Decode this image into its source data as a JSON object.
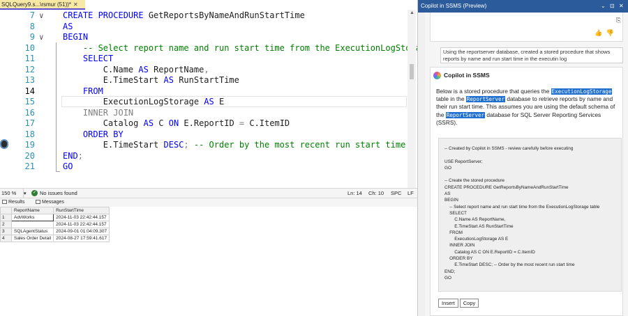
{
  "document_tab": {
    "title": "SQLQuery9.s...\\rsmur (51))*",
    "close_label": "✕"
  },
  "editor": {
    "lines": [
      {
        "number": "7",
        "fold": "∨",
        "parts": [
          {
            "cls": "k",
            "text": "CREATE PROCEDURE "
          },
          {
            "cls": "t",
            "text": "GetReportsByNameAndRunStartTime"
          }
        ]
      },
      {
        "number": "8",
        "fold": "",
        "parts": [
          {
            "cls": "k",
            "text": "AS"
          }
        ]
      },
      {
        "number": "9",
        "fold": "∨",
        "parts": [
          {
            "cls": "k",
            "text": "BEGIN"
          }
        ]
      },
      {
        "number": "10",
        "fold": "",
        "parts": [
          {
            "cls": "c",
            "text": "    -- Select report name and run start time from the ExecutionLogStorage"
          }
        ]
      },
      {
        "number": "11",
        "fold": "",
        "parts": [
          {
            "cls": "k",
            "text": "    SELECT"
          }
        ]
      },
      {
        "number": "12",
        "fold": "",
        "parts": [
          {
            "cls": "t",
            "text": "        C.Name "
          },
          {
            "cls": "k",
            "text": "AS "
          },
          {
            "cls": "t",
            "text": "ReportName"
          },
          {
            "cls": "g",
            "text": ","
          }
        ]
      },
      {
        "number": "13",
        "fold": "",
        "parts": [
          {
            "cls": "t",
            "text": "        E.TimeStart "
          },
          {
            "cls": "k",
            "text": "AS "
          },
          {
            "cls": "t",
            "text": "RunStartTime"
          }
        ]
      },
      {
        "number": "14",
        "fold": "",
        "parts": [
          {
            "cls": "k",
            "text": "    FROM"
          }
        ],
        "current": true
      },
      {
        "number": "15",
        "fold": "",
        "parts": [
          {
            "cls": "t",
            "text": "        ExecutionLogStorage "
          },
          {
            "cls": "k",
            "text": "AS "
          },
          {
            "cls": "t",
            "text": "E"
          }
        ]
      },
      {
        "number": "16",
        "fold": "",
        "parts": [
          {
            "cls": "g",
            "text": "    INNER JOIN"
          }
        ]
      },
      {
        "number": "17",
        "fold": "",
        "parts": [
          {
            "cls": "t",
            "text": "        Catalog "
          },
          {
            "cls": "k",
            "text": "AS "
          },
          {
            "cls": "t",
            "text": "C "
          },
          {
            "cls": "k",
            "text": "ON "
          },
          {
            "cls": "t",
            "text": "E.ReportID "
          },
          {
            "cls": "g",
            "text": "= "
          },
          {
            "cls": "t",
            "text": "C.ItemID"
          }
        ]
      },
      {
        "number": "18",
        "fold": "",
        "parts": [
          {
            "cls": "k",
            "text": "    ORDER BY"
          }
        ]
      },
      {
        "number": "19",
        "fold": "",
        "parts": [
          {
            "cls": "t",
            "text": "        E.TimeStart "
          },
          {
            "cls": "k",
            "text": "DESC"
          },
          {
            "cls": "g",
            "text": "; "
          },
          {
            "cls": "c",
            "text": "-- Order by the most recent run start time"
          }
        ]
      },
      {
        "number": "20",
        "fold": "",
        "parts": [
          {
            "cls": "k",
            "text": "END"
          },
          {
            "cls": "g",
            "text": ";"
          }
        ]
      },
      {
        "number": "21",
        "fold": "",
        "parts": [
          {
            "cls": "k",
            "text": "GO"
          }
        ]
      }
    ]
  },
  "status": {
    "zoom": "150 %",
    "issues": "No issues found",
    "ln": "Ln: 14",
    "ch": "Ch: 10",
    "mode": "SPC",
    "eol": "LF"
  },
  "results": {
    "tabs": {
      "results": "Results",
      "messages": "Messages"
    },
    "columns": [
      "ReportName",
      "RunStartTime"
    ],
    "rows": [
      {
        "n": "1",
        "name": "AdvWorks",
        "time": "2024-11-03 22:42:44.157"
      },
      {
        "n": "2",
        "name": "",
        "time": "2024-11-03 22:42:44.157"
      },
      {
        "n": "3",
        "name": "SQLAgentStatus",
        "time": "2024-09-01 01:04:09.307"
      },
      {
        "n": "4",
        "name": "Sales Order Detail",
        "time": "2024-08-27 17:59:41.617"
      }
    ]
  },
  "copilot": {
    "title": "Copilot in SSMS (Preview)",
    "window_controls": [
      "⌄",
      "⊡",
      "✕"
    ],
    "prompt": "Using the reportserver database, created a stored procedure that shows reports by name and run start time  in the executin log",
    "heading": "Copilot in SSMS",
    "intro": {
      "p1": "Below is a stored procedure that queries the",
      "hl1": "ExecutionLogStorage",
      "p2": " table in the ",
      "hl2": "ReportServer",
      "p3": " database to retrieve reports by name and their run start time. This assumes you are using the default schema of the ",
      "hl3": "ReportServer",
      "p4": " database for SQL Server Reporting Services (SSRS)."
    },
    "code_lines": [
      "-- Created by Copilot in SSMS - review carefully before executing",
      "",
      "USE ReportServer;",
      "GO",
      "",
      "-- Create the stored procedure",
      "CREATE PROCEDURE GetReportsByNameAndRunStartTime",
      "AS",
      "BEGIN",
      "    -- Select report name and run start time from the ExecutionLogStorage table",
      "    SELECT",
      "        C.Name AS ReportName,",
      "        E.TimeStart AS RunStartTime",
      "    FROM",
      "        ExecutionLogStorage AS E",
      "    INNER JOIN",
      "        Catalog AS C ON E.ReportID = C.ItemID",
      "    ORDER BY",
      "        E.TimeStart DESC; -- Order by the most recent run start time",
      "END;",
      "GO"
    ],
    "buttons": {
      "insert": "Insert",
      "copy": "Copy"
    },
    "actions": [
      "⎘",
      "👍",
      "👎"
    ]
  }
}
